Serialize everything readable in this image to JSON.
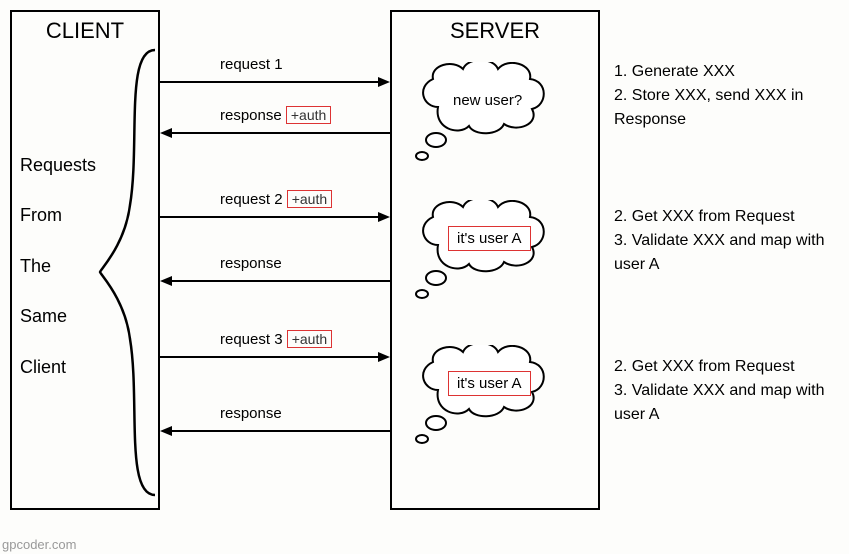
{
  "client": {
    "title": "CLIENT"
  },
  "server": {
    "title": "SERVER"
  },
  "side_label": {
    "l1": "Requests",
    "l2": "From",
    "l3": "The",
    "l4": "Same",
    "l5": "Client"
  },
  "arrows": {
    "req1": "request 1",
    "resp1_prefix": "response ",
    "auth": "+auth",
    "req2_prefix": "request 2 ",
    "resp2": "response",
    "req3_prefix": "request 3 ",
    "resp3": "response"
  },
  "clouds": {
    "c1": "new user?",
    "c2": "it's user A",
    "c3": "it's user A"
  },
  "notes": {
    "n1a": "1. Generate XXX",
    "n1b": "2. Store XXX, send XXX in Response",
    "n2a": "2. Get XXX from Request",
    "n2b": "3. Validate XXX and map with user A",
    "n3a": "2. Get XXX from Request",
    "n3b": "3. Validate XXX and map with user A"
  },
  "watermark": "gpcoder.com"
}
